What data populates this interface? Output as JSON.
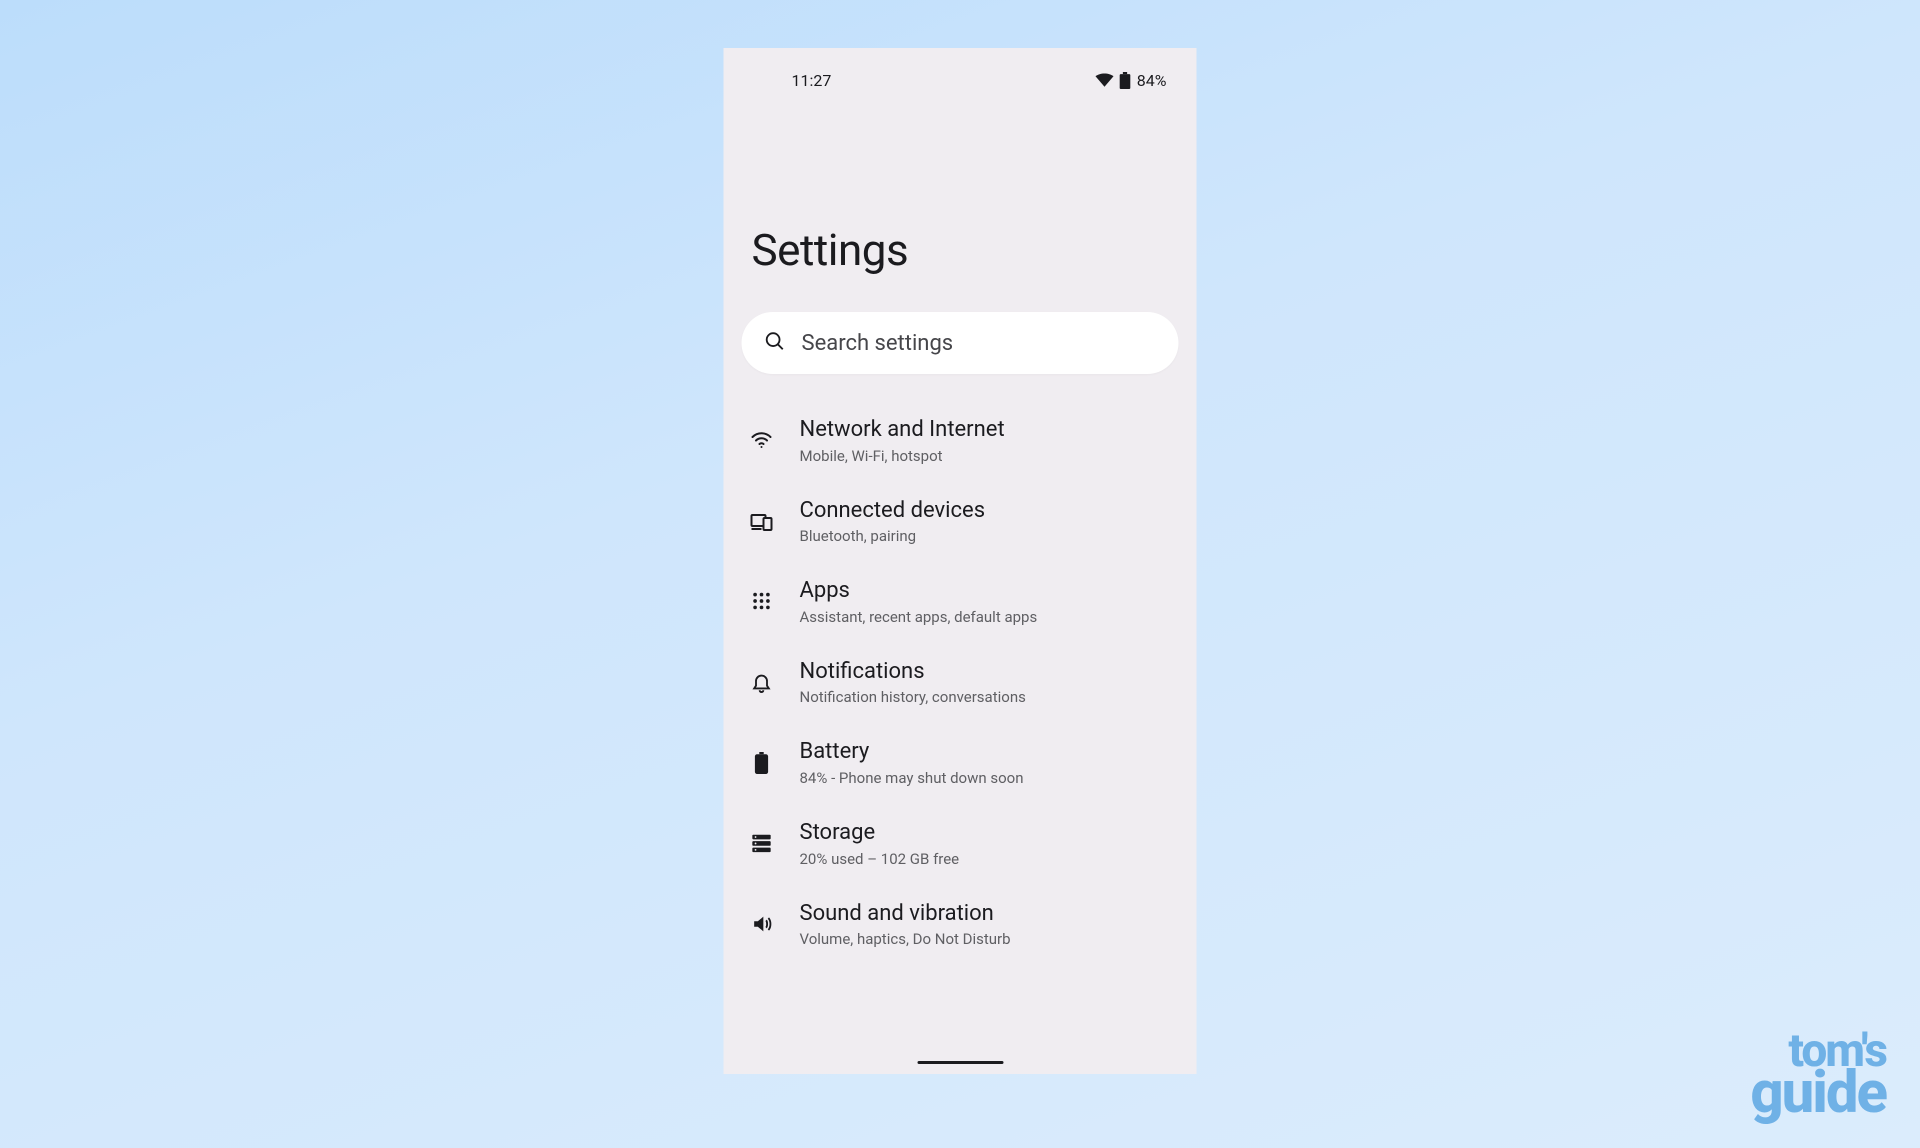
{
  "status": {
    "time": "11:27",
    "battery": "84%"
  },
  "page": {
    "title": "Settings"
  },
  "search": {
    "placeholder": "Search settings"
  },
  "items": [
    {
      "icon": "wifi-icon",
      "label": "Network and Internet",
      "sub": "Mobile, Wi-Fi, hotspot"
    },
    {
      "icon": "devices-icon",
      "label": "Connected devices",
      "sub": "Bluetooth, pairing"
    },
    {
      "icon": "apps-icon",
      "label": "Apps",
      "sub": "Assistant, recent apps, default apps"
    },
    {
      "icon": "bell-icon",
      "label": "Notifications",
      "sub": "Notification history, conversations"
    },
    {
      "icon": "battery-icon",
      "label": "Battery",
      "sub": "84% - Phone may shut down soon"
    },
    {
      "icon": "storage-icon",
      "label": "Storage",
      "sub": "20% used – 102 GB free"
    },
    {
      "icon": "volume-icon",
      "label": "Sound and vibration",
      "sub": "Volume, haptics, Do Not Disturb"
    }
  ],
  "watermark": {
    "line1": "tom's",
    "line2": "guide"
  }
}
